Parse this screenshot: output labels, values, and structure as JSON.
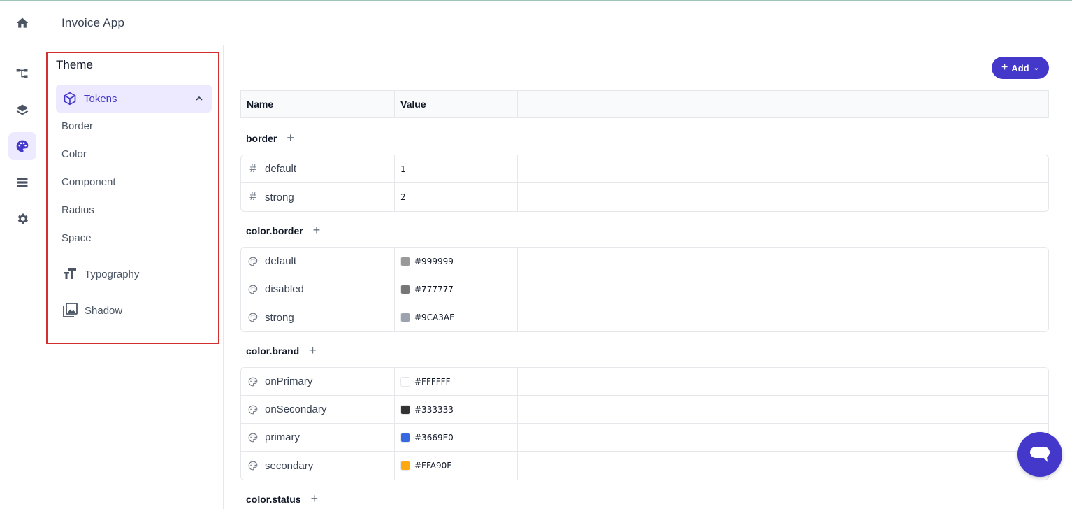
{
  "header": {
    "app_title": "Invoice App"
  },
  "theme_panel": {
    "title": "Theme",
    "tokens_label": "Tokens",
    "token_items": [
      "Border",
      "Color",
      "Component",
      "Radius",
      "Space"
    ],
    "typography_label": "Typography",
    "shadow_label": "Shadow"
  },
  "toolbar": {
    "add_label": "Add"
  },
  "table": {
    "columns": [
      "Name",
      "Value",
      ""
    ],
    "groups": [
      {
        "title": "border",
        "type": "number",
        "rows": [
          {
            "name": "default",
            "value": "1"
          },
          {
            "name": "strong",
            "value": "2"
          }
        ]
      },
      {
        "title": "color.border",
        "type": "color",
        "rows": [
          {
            "name": "default",
            "value": "#999999",
            "swatch": "#999999"
          },
          {
            "name": "disabled",
            "value": "#777777",
            "swatch": "#777777"
          },
          {
            "name": "strong",
            "value": "#9CA3AF",
            "swatch": "#9CA3AF"
          }
        ]
      },
      {
        "title": "color.brand",
        "type": "color",
        "rows": [
          {
            "name": "onPrimary",
            "value": "#FFFFFF",
            "swatch": "#FFFFFF"
          },
          {
            "name": "onSecondary",
            "value": "#333333",
            "swatch": "#333333"
          },
          {
            "name": "primary",
            "value": "#3669E0",
            "swatch": "#3669E0"
          },
          {
            "name": "secondary",
            "value": "#FFA90E",
            "swatch": "#FFA90E"
          }
        ]
      },
      {
        "title": "color.status",
        "type": "color",
        "rows": []
      }
    ]
  },
  "colors": {
    "accent": "#4338ca",
    "accent_light": "#ede9fe",
    "highlight_border": "#d32f2f"
  }
}
